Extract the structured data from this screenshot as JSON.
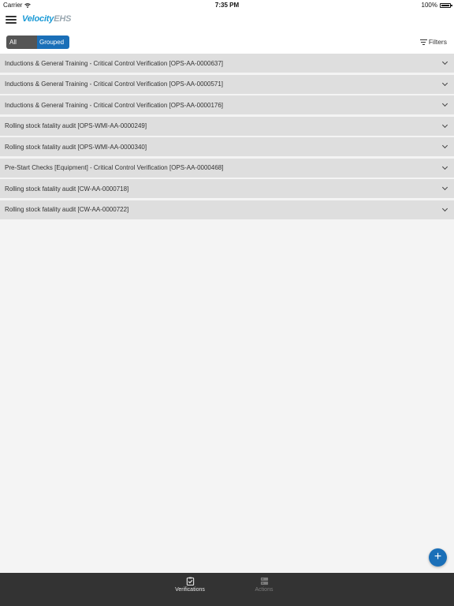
{
  "status_bar": {
    "carrier": "Carrier",
    "time": "7:35 PM",
    "battery": "100%"
  },
  "header": {
    "logo_velocity": "Velocity",
    "logo_ehs": "EHS",
    "segment": {
      "all_label": "All",
      "grouped_label": "Grouped",
      "selected": "Grouped"
    },
    "filters_label": "Filters"
  },
  "groups": [
    {
      "title": "Inductions & General Training - Critical Control Verification [OPS-AA-0000637]"
    },
    {
      "title": "Inductions & General Training - Critical Control Verification [OPS-AA-0000571]"
    },
    {
      "title": "Inductions & General Training - Critical Control Verification [OPS-AA-0000176]"
    },
    {
      "title": "Rolling stock fatality audit [OPS-WMI-AA-0000249]"
    },
    {
      "title": "Rolling stock fatality audit [OPS-WMI-AA-0000340]"
    },
    {
      "title": "Pre-Start Checks [Equipment] - Critical Control Verification [OPS-AA-0000468]"
    },
    {
      "title": "Rolling stock fatality audit [CW-AA-0000718]"
    },
    {
      "title": "Rolling stock fatality audit [CW-AA-0000722]"
    }
  ],
  "fab": {
    "icon": "plus-icon",
    "symbol": "+"
  },
  "tabs": [
    {
      "label": "Verifications",
      "icon": "clipboard-check-icon",
      "active": true
    },
    {
      "label": "Actions",
      "icon": "server-stack-icon",
      "active": false
    }
  ],
  "colors": {
    "accent": "#1a6fb8",
    "logo_blue": "#1b9ad6",
    "tabbar": "#333333",
    "row_bg": "#dedede"
  }
}
